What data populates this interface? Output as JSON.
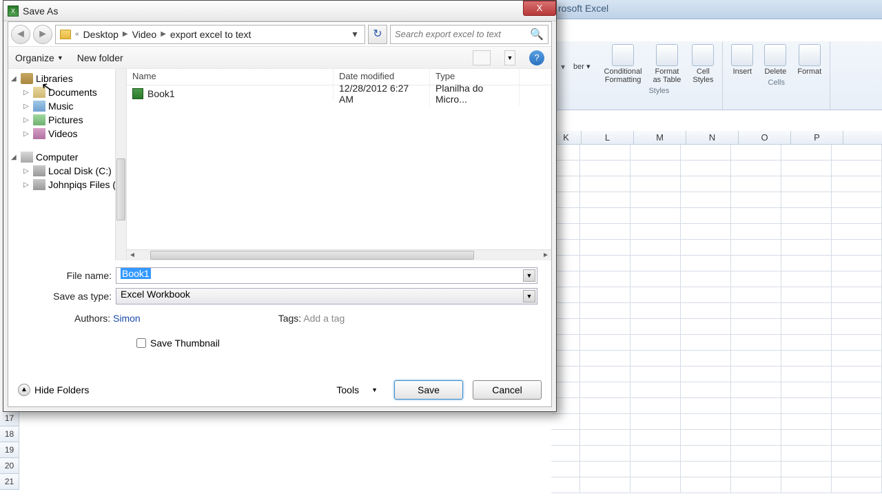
{
  "excel": {
    "title": "rosoft Excel",
    "ribbon_groups": [
      {
        "label": "Styles",
        "buttons": [
          "Conditional\nFormatting",
          "Format\nas Table",
          "Cell\nStyles"
        ]
      },
      {
        "label": "Cells",
        "buttons": [
          "Insert",
          "Delete",
          "Format"
        ]
      }
    ],
    "columns": [
      "K",
      "L",
      "M",
      "N",
      "O",
      "P"
    ],
    "rows_bottom": [
      "17",
      "18",
      "19",
      "20",
      "21"
    ]
  },
  "dialog": {
    "title": "Save As",
    "close": "X",
    "breadcrumb": [
      "Desktop",
      "Video",
      "export excel to text"
    ],
    "bc_prefix": "«",
    "search_placeholder": "Search export excel to text",
    "toolbar": {
      "organize": "Organize",
      "newfolder": "New folder"
    },
    "tree": {
      "libraries": "Libraries",
      "documents": "Documents",
      "music": "Music",
      "pictures": "Pictures",
      "videos": "Videos",
      "computer": "Computer",
      "localdisk": "Local Disk (C:)",
      "johnpiqs": "Johnpiqs Files (."
    },
    "list": {
      "cols": {
        "name": "Name",
        "date": "Date modified",
        "type": "Type"
      },
      "rows": [
        {
          "name": "Book1",
          "date": "12/28/2012 6:27 AM",
          "type": "Planilha do Micro..."
        }
      ]
    },
    "form": {
      "filename_label": "File name:",
      "filename_value": "Book1",
      "type_label": "Save as type:",
      "type_value": "Excel Workbook",
      "authors_label": "Authors:",
      "authors_value": "Simon",
      "tags_label": "Tags:",
      "tags_placeholder": "Add a tag",
      "thumbnail": "Save Thumbnail"
    },
    "footer": {
      "hide": "Hide Folders",
      "tools": "Tools",
      "save": "Save",
      "cancel": "Cancel"
    }
  }
}
